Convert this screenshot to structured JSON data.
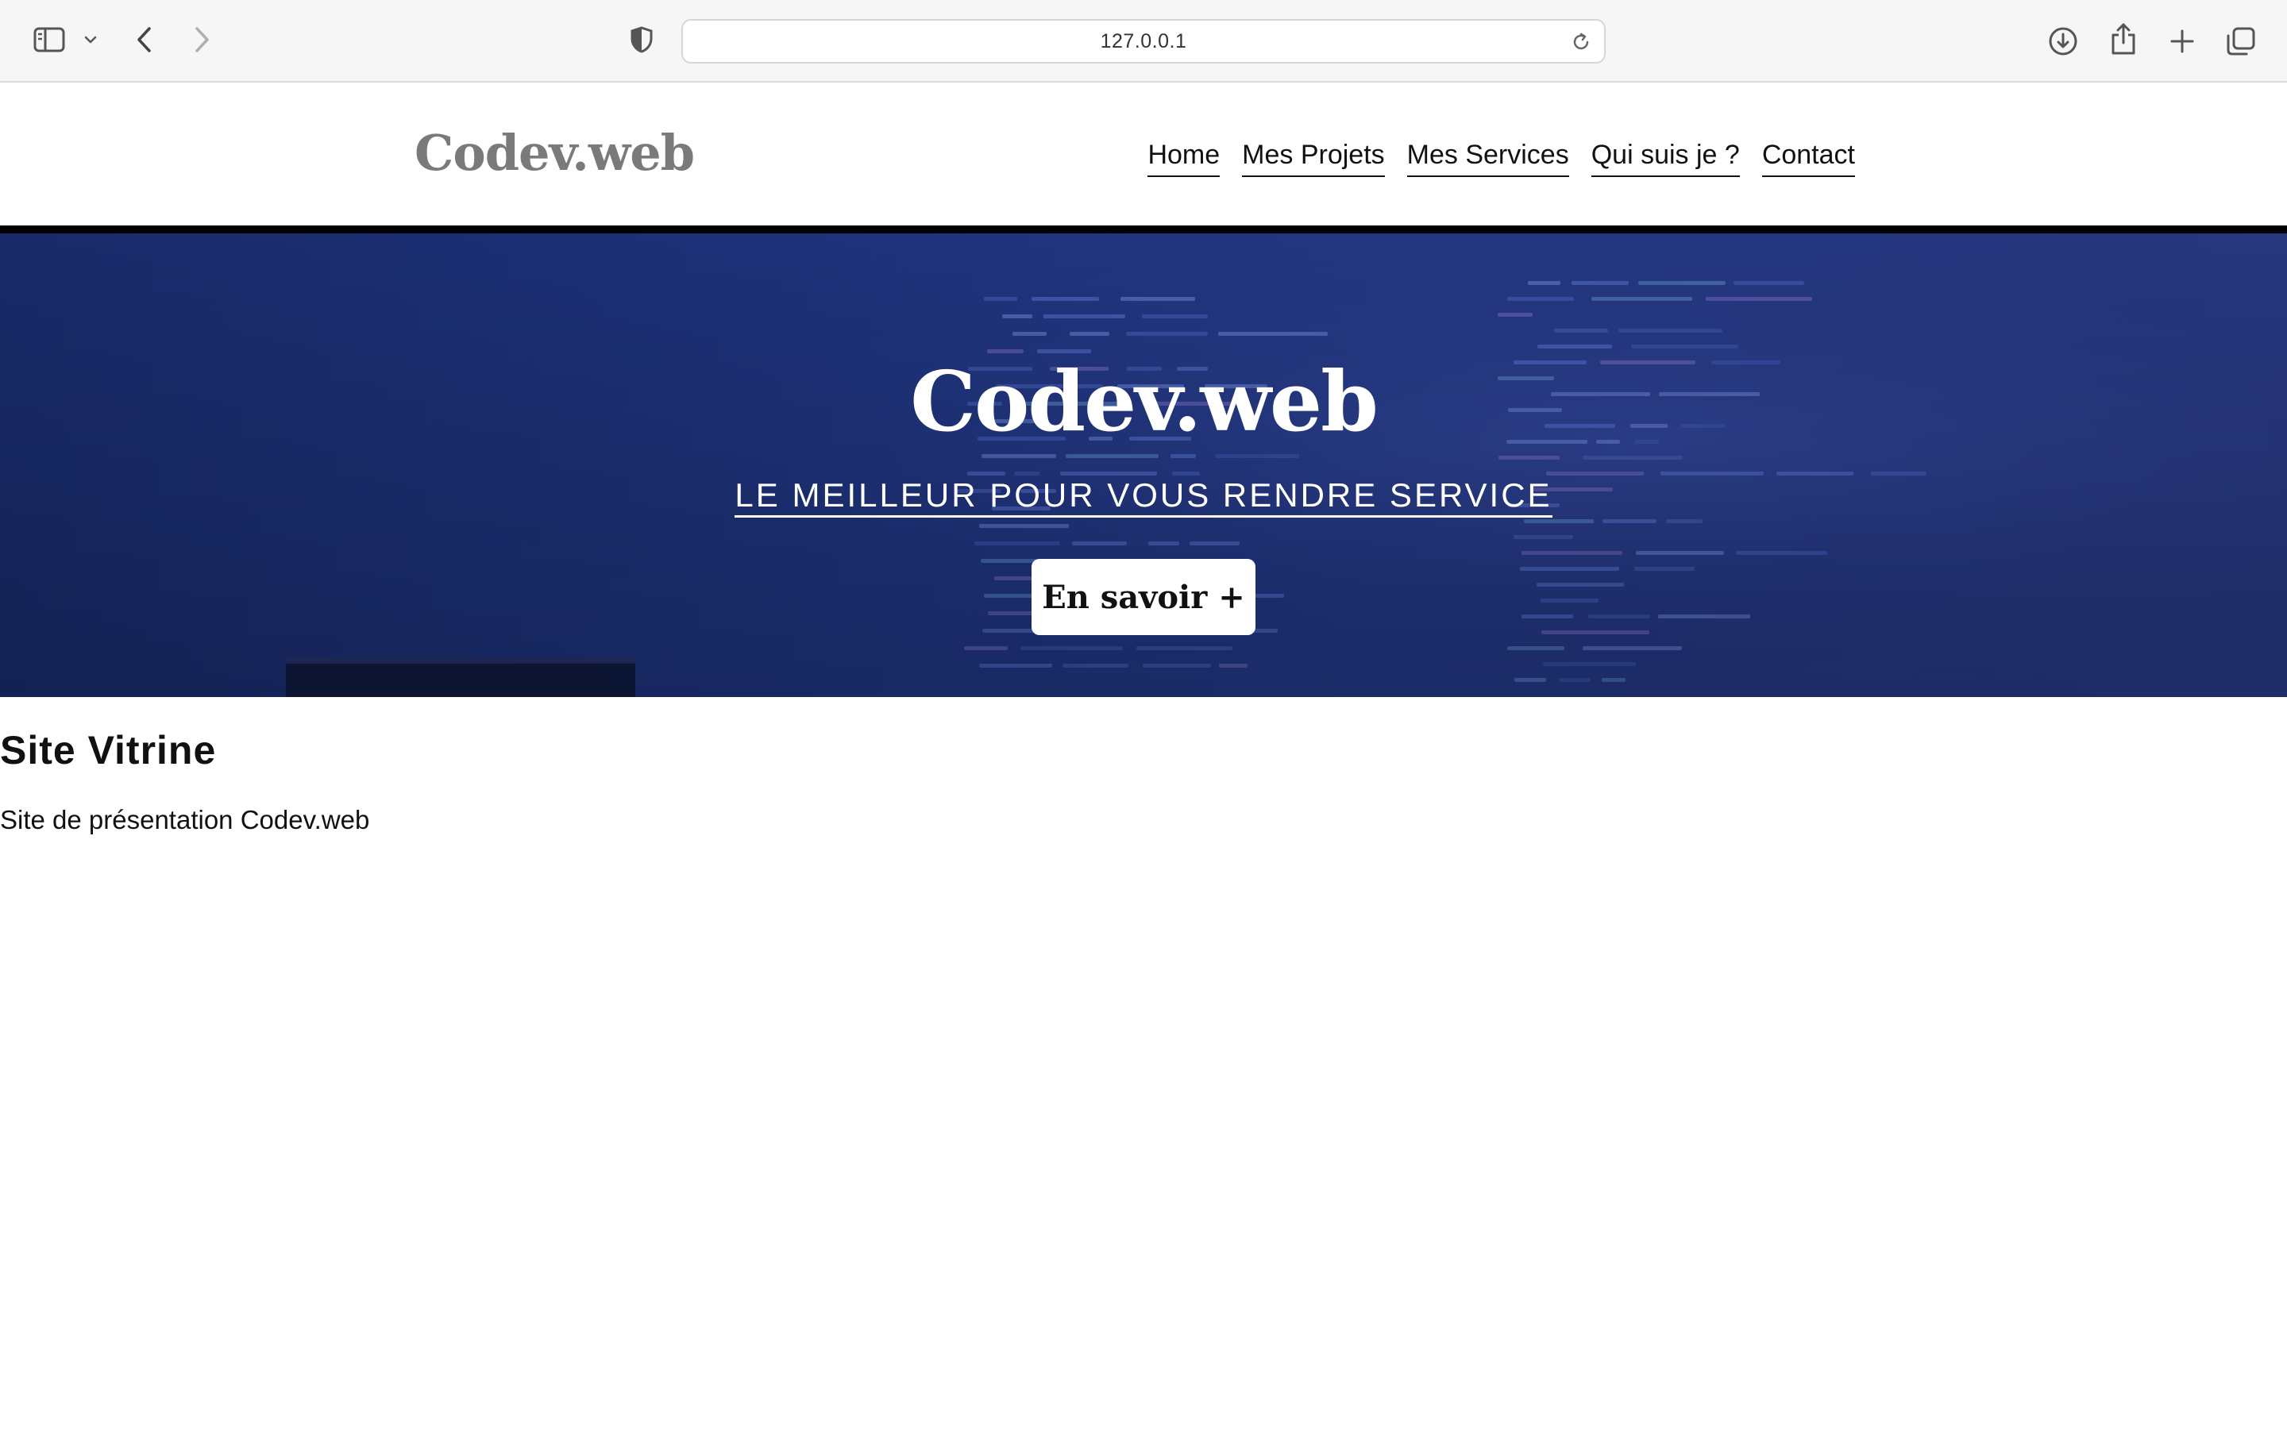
{
  "browser": {
    "url": "127.0.0.1",
    "icons": {
      "sidebar": "sidebar-icon",
      "chevron": "chevron-down-icon",
      "back": "back-arrow-icon",
      "forward": "forward-arrow-icon",
      "privacy": "shield-icon",
      "reload": "reload-icon",
      "download": "download-icon",
      "share": "share-icon",
      "new_tab": "plus-icon",
      "tabs": "tabs-overview-icon"
    }
  },
  "header": {
    "logo": "Codev.web",
    "nav": [
      "Home",
      "Mes Projets",
      "Mes Services",
      "Qui suis je ?",
      "Contact"
    ]
  },
  "hero": {
    "title": "Codev.web",
    "subtitle": "LE MEILLEUR POUR VOUS RENDRE SERVICE",
    "cta": "En savoir +"
  },
  "main": {
    "title": "Site Vitrine",
    "text": "Site de présentation Codev.web"
  },
  "colors": {
    "logo": "#7a7a7a",
    "hero_bg": "#223886",
    "header_rule": "#000000"
  }
}
